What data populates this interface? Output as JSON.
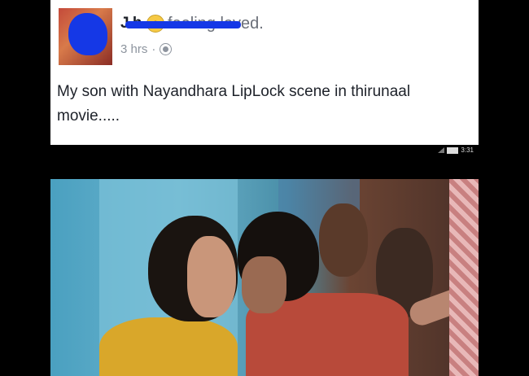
{
  "post": {
    "author_name": "J    h",
    "feeling_emoji": "☺",
    "feeling": "feeling loved.",
    "time": "3 hrs",
    "separator": "·",
    "privacy_icon": "globe-icon",
    "text": "My son with Nayandhara LipLock scene in thirunaal movie....."
  },
  "status_bar": {
    "time": "3:31"
  }
}
